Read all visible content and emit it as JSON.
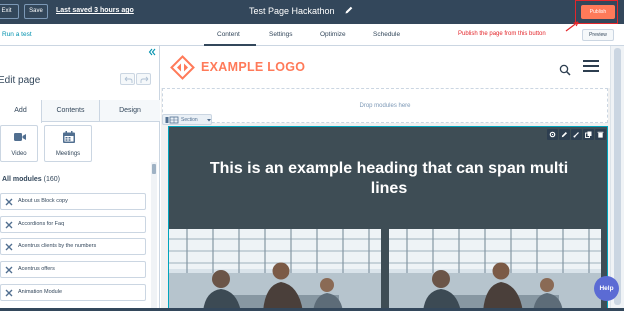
{
  "topbar": {
    "exit_label": "Exit",
    "save_label": "Save",
    "last_saved": "Last saved 3 hours ago",
    "page_title": "Test Page Hackathon",
    "publish_label": "Publish"
  },
  "subbar": {
    "run_test_label": "Run a test",
    "tabs": [
      {
        "label": "Content"
      },
      {
        "label": "Settings"
      },
      {
        "label": "Optimize"
      },
      {
        "label": "Schedule"
      }
    ],
    "annotation": "Publish the page from this button",
    "preview_label": "Preview"
  },
  "sidebar": {
    "title": "Edit page",
    "tabs": [
      {
        "label": "Add"
      },
      {
        "label": "Contents"
      },
      {
        "label": "Design"
      }
    ],
    "tiles": [
      {
        "label": "Video",
        "icon": "video-icon"
      },
      {
        "label": "Meetings",
        "icon": "calendar-icon"
      }
    ],
    "all_modules_label": "All modules",
    "all_modules_count": "(160)",
    "modules": [
      {
        "label": "About us Block copy"
      },
      {
        "label": "Accordions for Faq"
      },
      {
        "label": "Acentrus clients by the numbers"
      },
      {
        "label": "Acentrus offers"
      },
      {
        "label": "Animation Module"
      }
    ]
  },
  "canvas": {
    "logo_text": "EXAMPLE LOGO",
    "drop_zone_text": "Drop modules here",
    "section_label": "Section",
    "hero_heading": "This is an example heading that can span multi lines"
  },
  "help_label": "Help",
  "colors": {
    "topbar_bg": "#33475b",
    "publish_orange": "#ff7a59",
    "annotation_red": "#e3262b",
    "link_teal": "#0091ae",
    "section_bg": "#3e4d55",
    "help_purple": "#5b6bd4"
  }
}
